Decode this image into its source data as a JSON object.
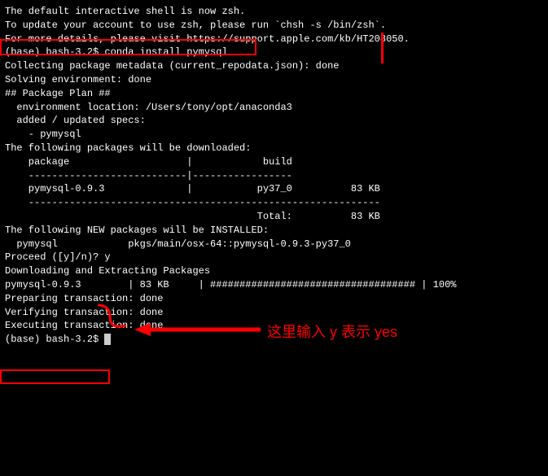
{
  "lines": {
    "l1": "The default interactive shell is now zsh.",
    "l2": "To update your account to use zsh, please run `chsh -s /bin/zsh`.",
    "l3": "For more details, please visit https://support.apple.com/kb/HT208050.",
    "prompt1_prefix": "(base) bash-3.2$ ",
    "prompt1_cmd": "conda install pymysql",
    "l5": "Collecting package metadata (current_repodata.json): done",
    "l6": "Solving environment: done",
    "l7": "",
    "l8": "## Package Plan ##",
    "l9": "",
    "l10": "  environment location: /Users/tony/opt/anaconda3",
    "l11": "",
    "l12": "  added / updated specs:",
    "l13": "    - pymysql",
    "l14": "",
    "l15": "",
    "l16": "The following packages will be downloaded:",
    "l17": "",
    "l18": "    package                    |            build",
    "l19": "    ---------------------------|-----------------",
    "l20": "    pymysql-0.9.3              |           py37_0          83 KB",
    "l21": "    ------------------------------------------------------------",
    "l22": "                                           Total:          83 KB",
    "l23": "",
    "l24": "The following NEW packages will be INSTALLED:",
    "l25": "",
    "l26": "  pymysql            pkgs/main/osx-64::pymysql-0.9.3-py37_0",
    "l27": "",
    "l28": "",
    "proceed_label": "Proceed ([y]/n)? ",
    "proceed_input": "y",
    "l30": "",
    "l31": "",
    "l32": "Downloading and Extracting Packages",
    "l33": "pymysql-0.9.3        | 83 KB     | ################################### | 100%",
    "l34": "Preparing transaction: done",
    "l35": "Verifying transaction: done",
    "l36": "Executing transaction: done",
    "prompt2": "(base) bash-3.2$ "
  },
  "annotation": "这里输入 y 表示 yes"
}
